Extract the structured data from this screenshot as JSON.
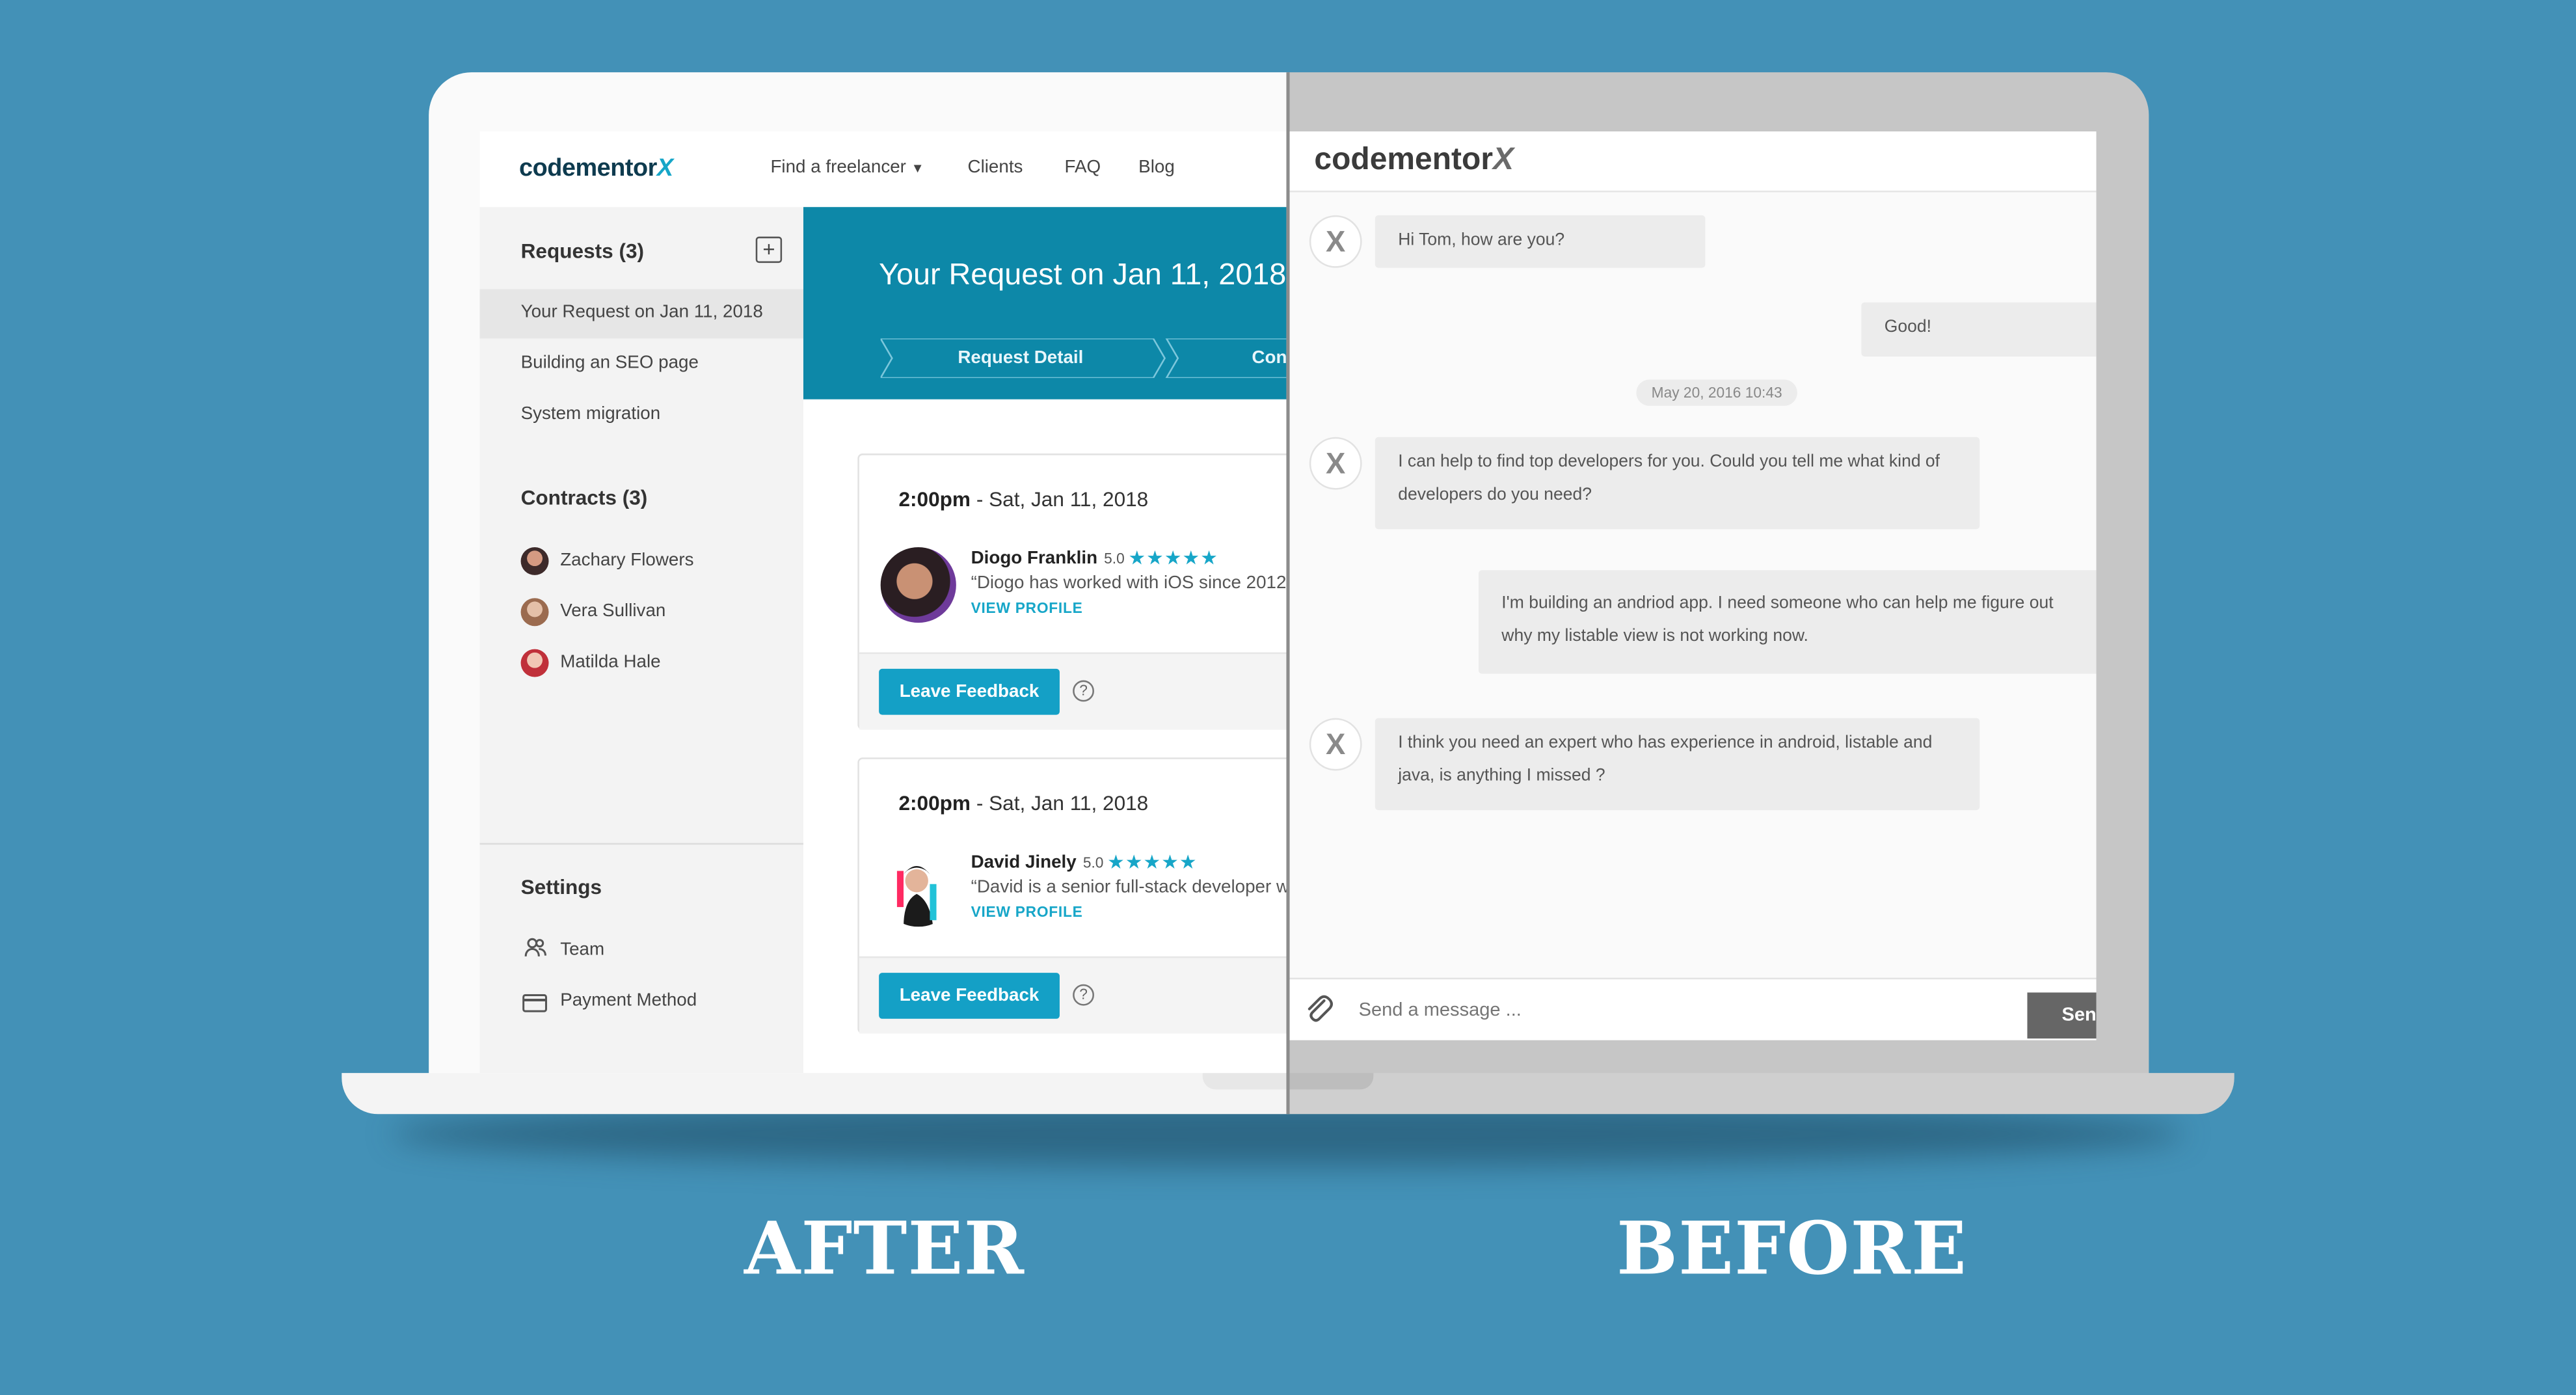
{
  "after": {
    "logo": {
      "text": "codementor",
      "x": "X"
    },
    "nav": {
      "find": "Find a freelancer",
      "clients": "Clients",
      "faq": "FAQ",
      "blog": "Blog"
    },
    "sidebar": {
      "requests_heading": "Requests (3)",
      "requests": [
        "Your Request on Jan 11, 2018",
        "Building an SEO page",
        "System migration"
      ],
      "contracts_heading": "Contracts (3)",
      "contracts": [
        "Zachary Flowers",
        "Vera Sullivan",
        "Matilda Hale"
      ],
      "settings_heading": "Settings",
      "settings": [
        "Team",
        "Payment Method"
      ]
    },
    "hero": {
      "title": "Your Request on Jan 11, 2018",
      "steps": [
        "Request Detail",
        "Con"
      ]
    },
    "cards": [
      {
        "time": "2:00pm",
        "date": "- Sat, Jan 11, 2018",
        "name": "Diogo Franklin",
        "rating": "5.0",
        "quote": "“Diogo has worked with iOS since 2012",
        "link": "VIEW PROFILE",
        "button": "Leave Feedback",
        "help": "?"
      },
      {
        "time": "2:00pm",
        "date": "- Sat, Jan 11, 2018",
        "name": "David Jinely",
        "rating": "5.0",
        "quote": "“David is a senior full-stack developer w",
        "link": "VIEW PROFILE",
        "button": "Leave Feedback",
        "help": "?"
      }
    ]
  },
  "before": {
    "logo": {
      "text": "codementor",
      "x": "X"
    },
    "messages": [
      "Hi Tom, how are you?",
      "Good!",
      "I can help to find top developers for you. Could you tell me what kind of developers do you need?",
      "I'm building an andriod app. I need someone who can help me figure out why my listable view is not working now.",
      "I think you need an expert who has experience in android, listable and java, is anything I missed ?"
    ],
    "timestamp": "May 20, 2016 10:43",
    "avatar_letter": "X",
    "input_placeholder": "Send a message ...",
    "send": "Send"
  },
  "labels": {
    "after": "AFTER",
    "before": "BEFORE"
  },
  "colors": {
    "background": "#4391b7",
    "accent": "#14a0c6",
    "hero": "#0d88a8"
  }
}
